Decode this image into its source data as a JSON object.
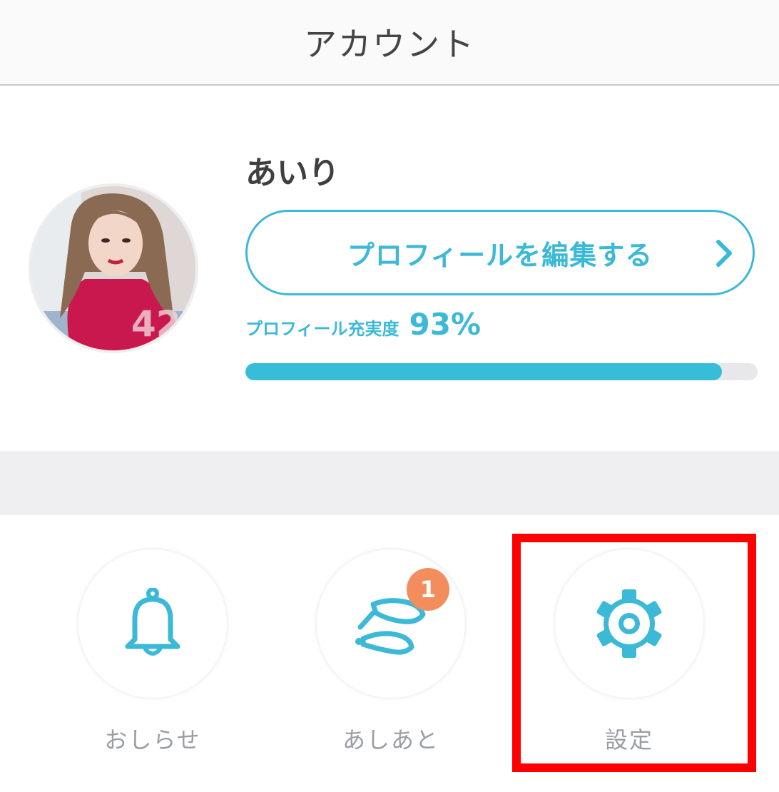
{
  "header": {
    "title": "アカウント"
  },
  "profile": {
    "name": "あいり",
    "edit_button_label": "プロフィールを編集する",
    "completion_label": "プロフィール充実度",
    "completion_value": "93%",
    "completion_fraction": 0.93
  },
  "menu": {
    "items": [
      {
        "label": "おしらせ",
        "icon": "bell-icon"
      },
      {
        "label": "あしあと",
        "icon": "footprints-icon",
        "badge": "1"
      },
      {
        "label": "設定",
        "icon": "gear-icon"
      }
    ]
  },
  "colors": {
    "accent": "#3bb9d6",
    "badge": "#f48d5d",
    "highlight": "#ff0000",
    "separator": "#efeff1"
  }
}
